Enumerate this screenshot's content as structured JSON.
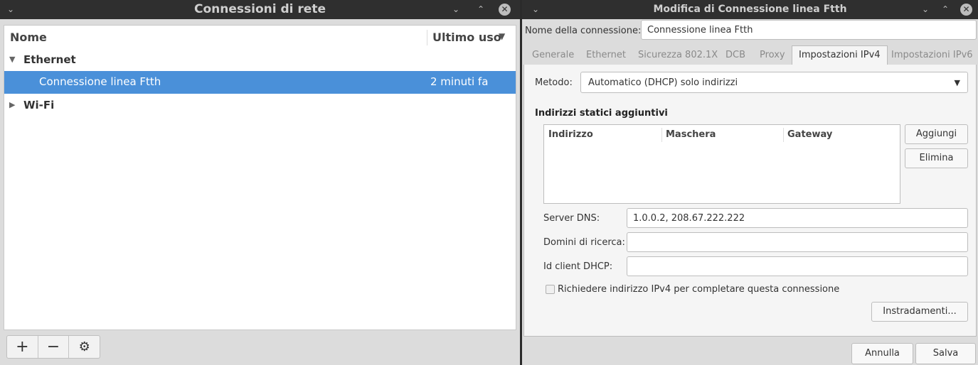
{
  "left_window": {
    "title": "Connessioni di rete",
    "column_name": "Nome",
    "column_last_used": "Ultimo uso",
    "groups": [
      {
        "label": "Ethernet",
        "expander": "▼"
      },
      {
        "label": "Wi-Fi",
        "expander": "▶"
      }
    ],
    "connection": {
      "name": "Connessione linea Ftth",
      "last_used": "2 minuti fa"
    },
    "toolbar": {
      "add": "+",
      "remove": "−",
      "settings": "⚙"
    }
  },
  "right_window": {
    "title": "Modifica di Connessione linea Ftth",
    "connection_name_label": "Nome della connessione:",
    "connection_name_value": "Connessione linea Ftth",
    "tabs": [
      "Generale",
      "Ethernet",
      "Sicurezza 802.1X",
      "DCB",
      "Proxy",
      "Impostazioni IPv4",
      "Impostazioni IPv6"
    ],
    "active_tab": "Impostazioni IPv4",
    "method_label": "Metodo:",
    "method_value": "Automatico (DHCP) solo indirizzi",
    "static_section_title": "Indirizzi statici aggiuntivi",
    "table_columns": [
      "Indirizzo",
      "Maschera",
      "Gateway"
    ],
    "add_button": "Aggiungi",
    "delete_button": "Elimina",
    "dns_label": "Server DNS:",
    "dns_value": "1.0.0.2, 208.67.222.222",
    "search_domains_label": "Domini di ricerca:",
    "search_domains_value": "",
    "dhcp_client_id_label": "Id client DHCP:",
    "dhcp_client_id_value": "",
    "require_ipv4_label": "Richiedere indirizzo IPv4 per completare questa connessione",
    "require_ipv4_checked": false,
    "routes_button": "Instradamenti...",
    "cancel_button": "Annulla",
    "save_button": "Salva"
  },
  "icons": {
    "window_menu": "chevron-down-icon",
    "minimize": "minimize-icon",
    "maximize": "maximize-icon",
    "close": "close-icon"
  }
}
